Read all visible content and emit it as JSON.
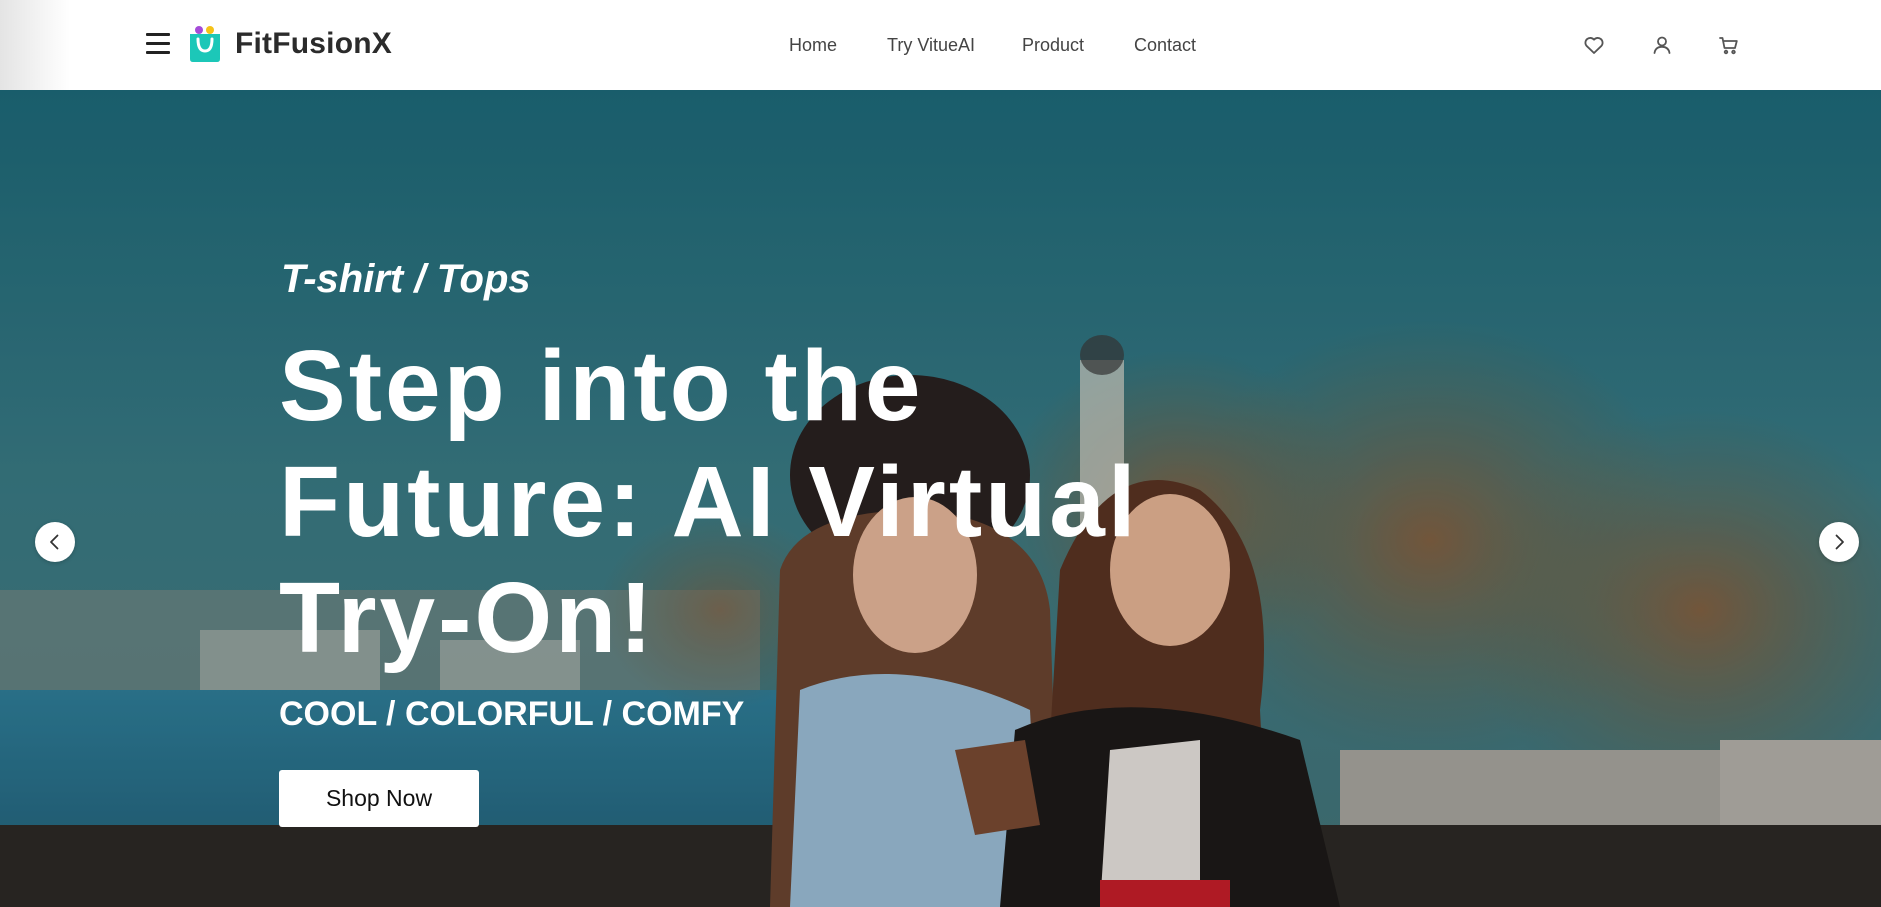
{
  "brand": {
    "name": "FitFusionX",
    "logo_icon": "shopping-bag-icon",
    "logo_colors": {
      "bag": "#1cc7b8",
      "handle": "#ffffff",
      "dot1": "#a44bd8",
      "dot2": "#f5c218"
    }
  },
  "nav": {
    "items": [
      {
        "label": "Home"
      },
      {
        "label": "Try VitueAI"
      },
      {
        "label": "Product"
      },
      {
        "label": "Contact"
      }
    ]
  },
  "header_icons": [
    "menu-icon",
    "heart-icon",
    "user-icon",
    "cart-icon"
  ],
  "hero": {
    "subtitle": "T-shirt / Tops",
    "title": "Step into the Future: AI Virtual Try-On!",
    "tagline": "COOL / COLORFUL / COMFY",
    "cta_label": "Shop Now",
    "prev_icon": "chevron-left-icon",
    "next_icon": "chevron-right-icon"
  },
  "colors": {
    "text_dark": "#2b2b2b",
    "nav_text": "#444444",
    "hero_text": "#ffffff",
    "button_bg": "#ffffff"
  }
}
